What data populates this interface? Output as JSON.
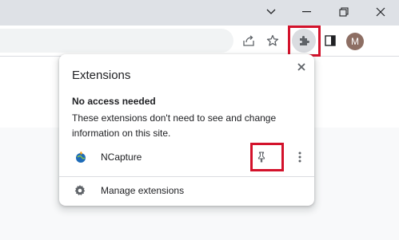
{
  "window": {
    "controls": [
      "minimize",
      "restore",
      "close"
    ]
  },
  "toolbar": {
    "icons": [
      "share-icon",
      "star-icon",
      "extensions-icon",
      "side-panel-icon"
    ],
    "profile_initial": "M"
  },
  "popup": {
    "title": "Extensions",
    "section_title": "No access needed",
    "section_desc": "These extensions don't need to see and change information on this site.",
    "extension": {
      "name": "NCapture"
    },
    "manage_label": "Manage extensions"
  },
  "colors": {
    "highlight": "#d3122b",
    "avatar": "#8d6e63"
  }
}
